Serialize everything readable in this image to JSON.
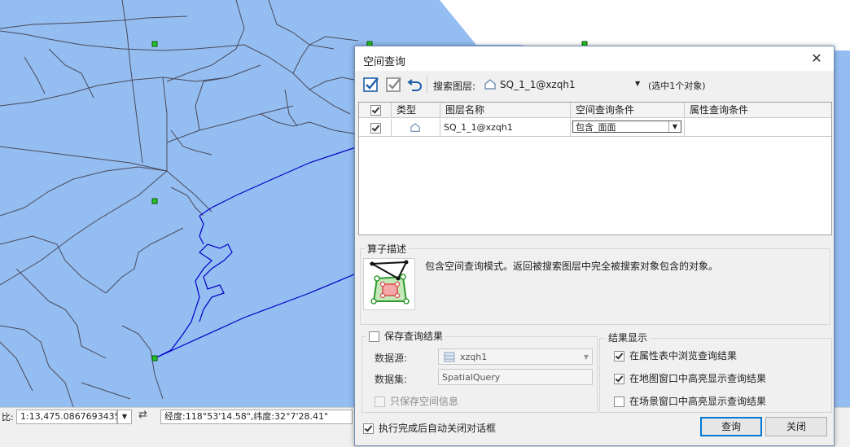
{
  "colors": {
    "map_fill": "#94bdf2",
    "map_lines": "#4a4a5a",
    "route": "#0000c8",
    "node": "#22c322"
  },
  "statusbar": {
    "lead": "比:",
    "scale": "1:13,475.0867693435",
    "coords": "经度:118°53'14.58\",纬度:32°7'28.41\""
  },
  "dialog": {
    "title": "空间查询",
    "toolbar": {
      "icons": [
        "select-all-icon",
        "select-none-icon",
        "undo-icon"
      ],
      "search_label": "搜索图层:",
      "search_layer": "SQ_1_1@xzqh1",
      "selection_count": "(选中1个对象)"
    },
    "grid": {
      "headers": {
        "type": "类型",
        "layer_name": "图层名称",
        "spatial_condition": "空间查询条件",
        "attr_condition": "属性查询条件"
      },
      "rows": [
        {
          "checked": true,
          "type_icon": "polygon-layer-icon",
          "layer_name": "SQ_1_1@xzqh1",
          "spatial_condition": "包含_面面",
          "attr_condition": ""
        }
      ]
    },
    "operator": {
      "title": "算子描述",
      "description": "包含空间查询模式。返回被搜索图层中完全被搜索对象包含的对象。"
    },
    "save": {
      "title": "保存查询结果",
      "datasource_label": "数据源:",
      "datasource_value": "xzqh1",
      "dataset_label": "数据集:",
      "dataset_value": "SpatialQuery",
      "only_spatial": "只保存空间信息"
    },
    "display": {
      "title": "结果显示",
      "options": [
        "在属性表中浏览查询结果",
        "在地图窗口中高亮显示查询结果",
        "在场景窗口中高亮显示查询结果"
      ],
      "checked": [
        true,
        true,
        false
      ]
    },
    "auto_close": "执行完成后自动关闭对话框",
    "query_button": "查询",
    "close_button": "关闭"
  }
}
